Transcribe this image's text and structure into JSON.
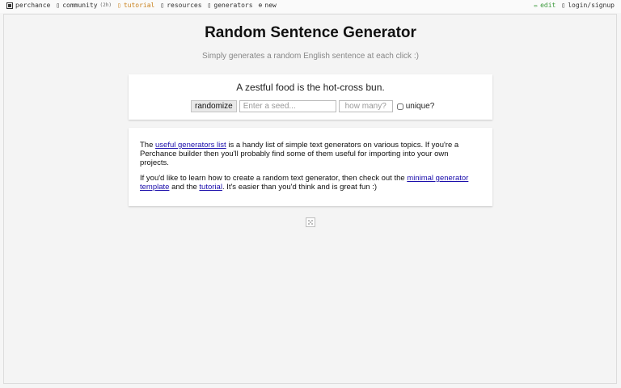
{
  "topbar": {
    "left": [
      {
        "label": "perchance",
        "icon": "die-icon"
      },
      {
        "label": "community",
        "note": "(2h)",
        "icon": "chat-icon"
      },
      {
        "label": "tutorial",
        "icon": "book-icon",
        "highlight": "#c9821f"
      },
      {
        "label": "resources",
        "icon": "box-icon"
      },
      {
        "label": "generators",
        "icon": "grid-icon"
      },
      {
        "label": "new",
        "icon": "plus-circle-icon"
      }
    ],
    "right": [
      {
        "label": "edit",
        "icon": "pencil-icon",
        "color": "#3c9a3c"
      },
      {
        "label": "login/signup",
        "icon": "user-icon"
      }
    ]
  },
  "page": {
    "title": "Random Sentence Generator",
    "subtitle": "Simply generates a random English sentence at each click :)"
  },
  "generator": {
    "output": "A zestful food is the hot-cross bun.",
    "randomize_label": "randomize",
    "seed_placeholder": "Enter a seed...",
    "count_placeholder": "how many?",
    "unique_label": "unique?"
  },
  "info": {
    "p1_prefix": "The ",
    "p1_link": "useful generators list",
    "p1_rest": " is a handy list of simple text generators on various topics. If you're a Perchance builder then you'll probably find some of them useful for importing into your own projects.",
    "p2_prefix": "If you'd like to learn how to create a random text generator, then check out the ",
    "p2_link1": "minimal generator template",
    "p2_mid": " and the ",
    "p2_link2": "tutorial",
    "p2_suffix": ". It's easier than you'd think and is great fun :)"
  }
}
